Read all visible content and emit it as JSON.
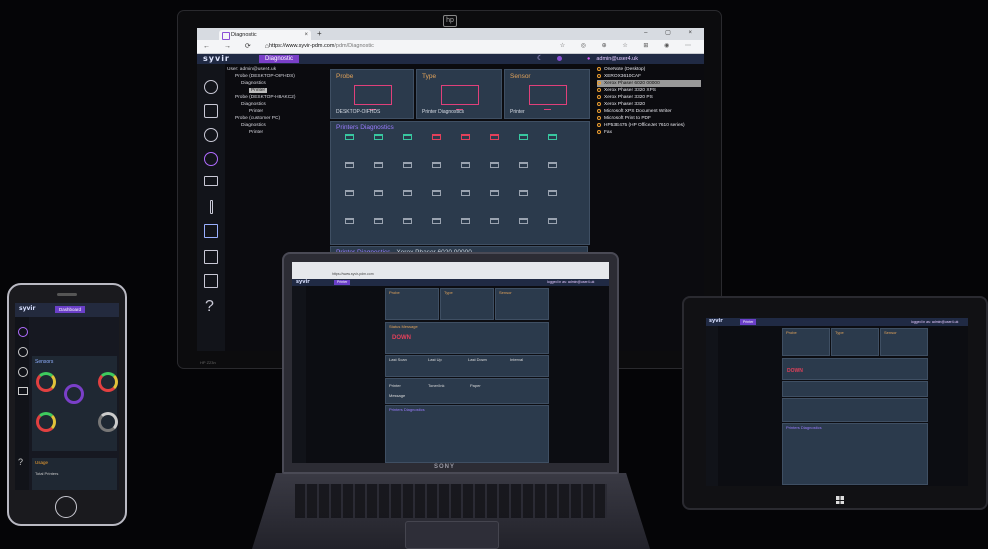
{
  "monitor": {
    "brand_logo": "hp",
    "model_label": "HP Z23n",
    "browser": {
      "tab_title": "Diagnostic",
      "url_host": "https://www.syvir-pdm.com",
      "url_path": "/pdm/Diagnostic"
    },
    "app": {
      "brand": "syvir",
      "title": "Diagnostic",
      "user": "admin@user4.uk",
      "tree": [
        "User: admin@user4.uk",
        "Probe (DESKTOP-OIFHDS)",
        "Diagnostics",
        "Printer",
        "Probe (DESKTOP-H8AKC2)",
        "Diagnostics",
        "Printer",
        "Probe (customer PC)",
        "Diagnostics",
        "Printer"
      ],
      "cards": [
        {
          "title": "Probe",
          "value": "DESKTOP-OIFHDS"
        },
        {
          "title": "Type",
          "value": "Printer Diagnostics"
        },
        {
          "title": "Sensor",
          "value": "Printer"
        }
      ],
      "panel_title": "Printers Diagnostics",
      "panel2_title": "Printer Diagnostics",
      "panel2_value": "- Xerox Phaser 6020 00000",
      "printers_list": [
        "OneNote (Desktop)",
        "XEROX3610CAF",
        "Xerox Phaser 6020 00000",
        "Xerox Phaser 3320 XPS",
        "Xerox Phaser 3320 PS",
        "Xerox Phaser 3320",
        "Microsoft XPS Document Writer",
        "Microsoft Print to PDF",
        "HP53E475 (HP OfficeJet 7610 series)",
        "Fax"
      ],
      "selected_printer_index": 2
    }
  },
  "phone": {
    "brand": "syvir",
    "title": "Dashboard",
    "sensors_label": "Sensors",
    "usage_label": "Usage",
    "usage_text": "Total Printers"
  },
  "laptop": {
    "brand": "syvir",
    "title": "Printer",
    "maker": "SONY",
    "user": "logged in as: admin@user4.uk",
    "status_label": "Status Message",
    "status_value": "DOWN",
    "last_scan": "Last Scan",
    "last_up": "Last Up",
    "last_down": "Last Down",
    "interval": "Interval",
    "diag_title": "Printers Diagnostics",
    "printer_label": "Printer",
    "toner_label": "Toner/Ink",
    "paper_label": "Paper",
    "message_label": "Message"
  },
  "tablet": {
    "brand": "syvir",
    "title": "Printer",
    "user": "logged in as: admin@user4.uk",
    "status_value": "DOWN",
    "diag_title": "Printers Diagnostics"
  },
  "colors": {
    "accent_purple": "#7a3fc8",
    "status_green": "#38c7a0",
    "status_red": "#e2405a",
    "label_orange": "#e0a25a"
  }
}
